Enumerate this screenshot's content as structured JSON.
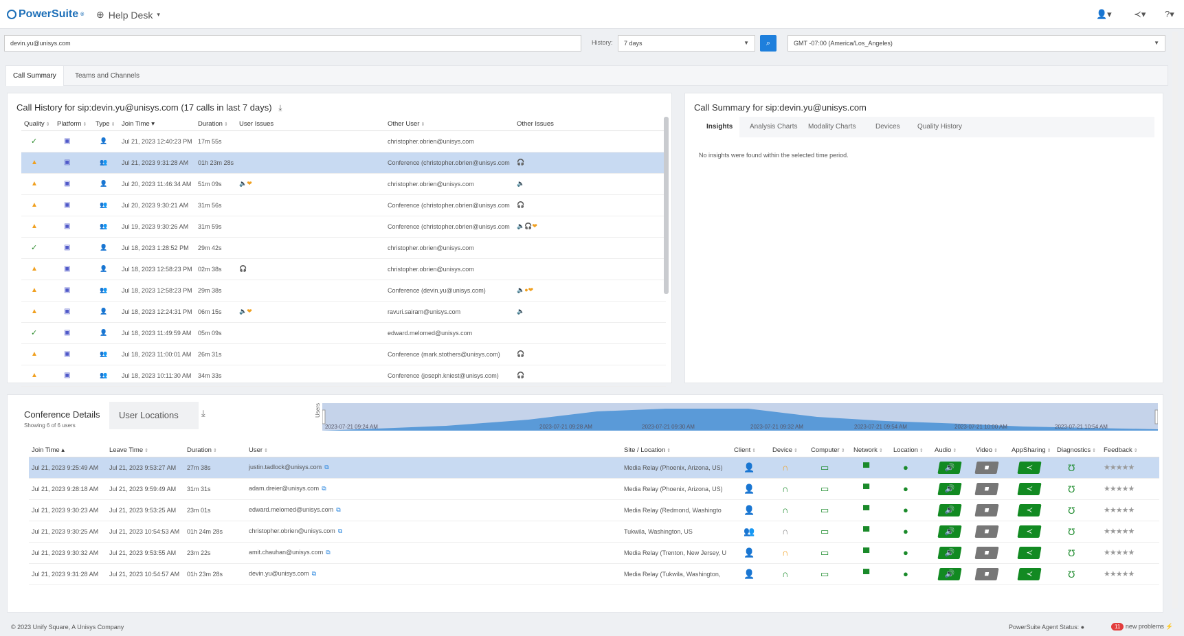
{
  "app": {
    "name": "PowerSuite",
    "tm": "®",
    "module": "Help Desk"
  },
  "search": {
    "user": "devin.yu@unisys.com",
    "history_label": "History:",
    "history_value": "7 days",
    "timezone": "GMT -07:00 (America/Los_Angeles)"
  },
  "tabs": [
    "Call Summary",
    "Teams and Channels"
  ],
  "history": {
    "title": "Call History for sip:devin.yu@unisys.com (17 calls in last 7 days)",
    "columns": [
      "Quality",
      "Platform",
      "Type",
      "Join Time",
      "Duration",
      "User Issues",
      "Other User",
      "Other Issues"
    ],
    "rows": [
      {
        "quality": "ok",
        "type": "single",
        "join": "Jul 21, 2023 12:40:23 PM",
        "duration": "17m 55s",
        "user_issues": "",
        "other": "christopher.obrien@unisys.com",
        "other_issues": "",
        "selected": false
      },
      {
        "quality": "warn",
        "type": "group",
        "join": "Jul 21, 2023 9:31:28 AM",
        "duration": "01h 23m 28s",
        "user_issues": "",
        "other": "Conference (christopher.obrien@unisys.com",
        "other_issues": "🎧",
        "selected": true
      },
      {
        "quality": "warn",
        "type": "single",
        "join": "Jul 20, 2023 11:46:34 AM",
        "duration": "51m 09s",
        "user_issues": "🔈❤",
        "other": "christopher.obrien@unisys.com",
        "other_issues": "🔈",
        "selected": false
      },
      {
        "quality": "warn",
        "type": "group",
        "join": "Jul 20, 2023 9:30:21 AM",
        "duration": "31m 56s",
        "user_issues": "",
        "other": "Conference (christopher.obrien@unisys.com",
        "other_issues": "🎧",
        "selected": false
      },
      {
        "quality": "warn",
        "type": "group",
        "join": "Jul 19, 2023 9:30:26 AM",
        "duration": "31m 59s",
        "user_issues": "",
        "other": "Conference (christopher.obrien@unisys.com",
        "other_issues": "🔈🎧❤",
        "selected": false
      },
      {
        "quality": "ok",
        "type": "single",
        "join": "Jul 18, 2023 1:28:52 PM",
        "duration": "29m 42s",
        "user_issues": "",
        "other": "christopher.obrien@unisys.com",
        "other_issues": "",
        "selected": false
      },
      {
        "quality": "warn",
        "type": "single",
        "join": "Jul 18, 2023 12:58:23 PM",
        "duration": "02m 38s",
        "user_issues": "🎧",
        "other": "christopher.obrien@unisys.com",
        "other_issues": "",
        "selected": false
      },
      {
        "quality": "warn",
        "type": "group",
        "join": "Jul 18, 2023 12:58:23 PM",
        "duration": "29m 38s",
        "user_issues": "",
        "other": "Conference (devin.yu@unisys.com)",
        "other_issues": "🔈●❤",
        "selected": false
      },
      {
        "quality": "warn",
        "type": "single",
        "join": "Jul 18, 2023 12:24:31 PM",
        "duration": "06m 15s",
        "user_issues": "🔈❤",
        "other": "ravuri.sairam@unisys.com",
        "other_issues": "🔈",
        "selected": false
      },
      {
        "quality": "ok",
        "type": "single",
        "join": "Jul 18, 2023 11:49:59 AM",
        "duration": "05m 09s",
        "user_issues": "",
        "other": "edward.melomed@unisys.com",
        "other_issues": "",
        "selected": false
      },
      {
        "quality": "warn",
        "type": "group",
        "join": "Jul 18, 2023 11:00:01 AM",
        "duration": "26m 31s",
        "user_issues": "",
        "other": "Conference (mark.stothers@unisys.com)",
        "other_issues": "🎧",
        "selected": false
      },
      {
        "quality": "warn",
        "type": "group",
        "join": "Jul 18, 2023 10:11:30 AM",
        "duration": "34m 33s",
        "user_issues": "",
        "other": "Conference (joseph.kniest@unisys.com)",
        "other_issues": "🎧",
        "selected": false
      }
    ]
  },
  "summary": {
    "title": "Call Summary for sip:devin.yu@unisys.com",
    "tabs": [
      "Insights",
      "Analysis Charts",
      "Modality Charts",
      "Devices",
      "Quality History"
    ],
    "message": "No insights were found within the selected time period."
  },
  "conference": {
    "tab1": "Conference Details",
    "tab2": "User Locations",
    "showing": "Showing 6 of 6 users",
    "axis_label": "Users",
    "timeline_labels": [
      "2023-07-21 09:24 AM",
      "2023-07-21 09:28 AM",
      "2023-07-21 09:30 AM",
      "2023-07-21 09:32 AM",
      "2023-07-21 09:54 AM",
      "2023-07-21 10:00 AM",
      "2023-07-21 10:54 AM"
    ],
    "columns": [
      "Join Time",
      "Leave Time",
      "Duration",
      "User",
      "Site / Location",
      "Client",
      "Device",
      "Computer",
      "Network",
      "Location",
      "Audio",
      "Video",
      "AppSharing",
      "Diagnostics",
      "Feedback"
    ],
    "rows": [
      {
        "join": "Jul 21, 2023 9:25:49 AM",
        "leave": "Jul 21, 2023 9:53:27 AM",
        "duration": "27m 38s",
        "user": "justin.tadlock@unisys.com",
        "site": "Media Relay (Phoenix, Arizona, US)",
        "device": "orange",
        "client": "single",
        "selected": true
      },
      {
        "join": "Jul 21, 2023 9:28:18 AM",
        "leave": "Jul 21, 2023 9:59:49 AM",
        "duration": "31m 31s",
        "user": "adam.dreier@unisys.com",
        "site": "Media Relay (Phoenix, Arizona, US)",
        "device": "green",
        "client": "single",
        "selected": false
      },
      {
        "join": "Jul 21, 2023 9:30:23 AM",
        "leave": "Jul 21, 2023 9:53:25 AM",
        "duration": "23m 01s",
        "user": "edward.melomed@unisys.com",
        "site": "Media Relay (Redmond, Washingto",
        "device": "green",
        "client": "single",
        "selected": false
      },
      {
        "join": "Jul 21, 2023 9:30:25 AM",
        "leave": "Jul 21, 2023 10:54:53 AM",
        "duration": "01h 24m 28s",
        "user": "christopher.obrien@unisys.com",
        "site": "Tukwila, Washington, US",
        "device": "gray",
        "client": "group",
        "selected": false
      },
      {
        "join": "Jul 21, 2023 9:30:32 AM",
        "leave": "Jul 21, 2023 9:53:55 AM",
        "duration": "23m 22s",
        "user": "amit.chauhan@unisys.com",
        "site": "Media Relay (Trenton, New Jersey, U",
        "device": "orange",
        "client": "single",
        "selected": false
      },
      {
        "join": "Jul 21, 2023 9:31:28 AM",
        "leave": "Jul 21, 2023 10:54:57 AM",
        "duration": "01h 23m 28s",
        "user": "devin.yu@unisys.com",
        "site": "Media Relay (Tukwila, Washington,",
        "device": "green",
        "client": "single",
        "selected": false
      }
    ]
  },
  "footer": {
    "copyright": "© 2023 Unify Square, A Unisys Company",
    "agent": "PowerSuite Agent Status:",
    "problems_count": "11",
    "problems": "new problems"
  }
}
